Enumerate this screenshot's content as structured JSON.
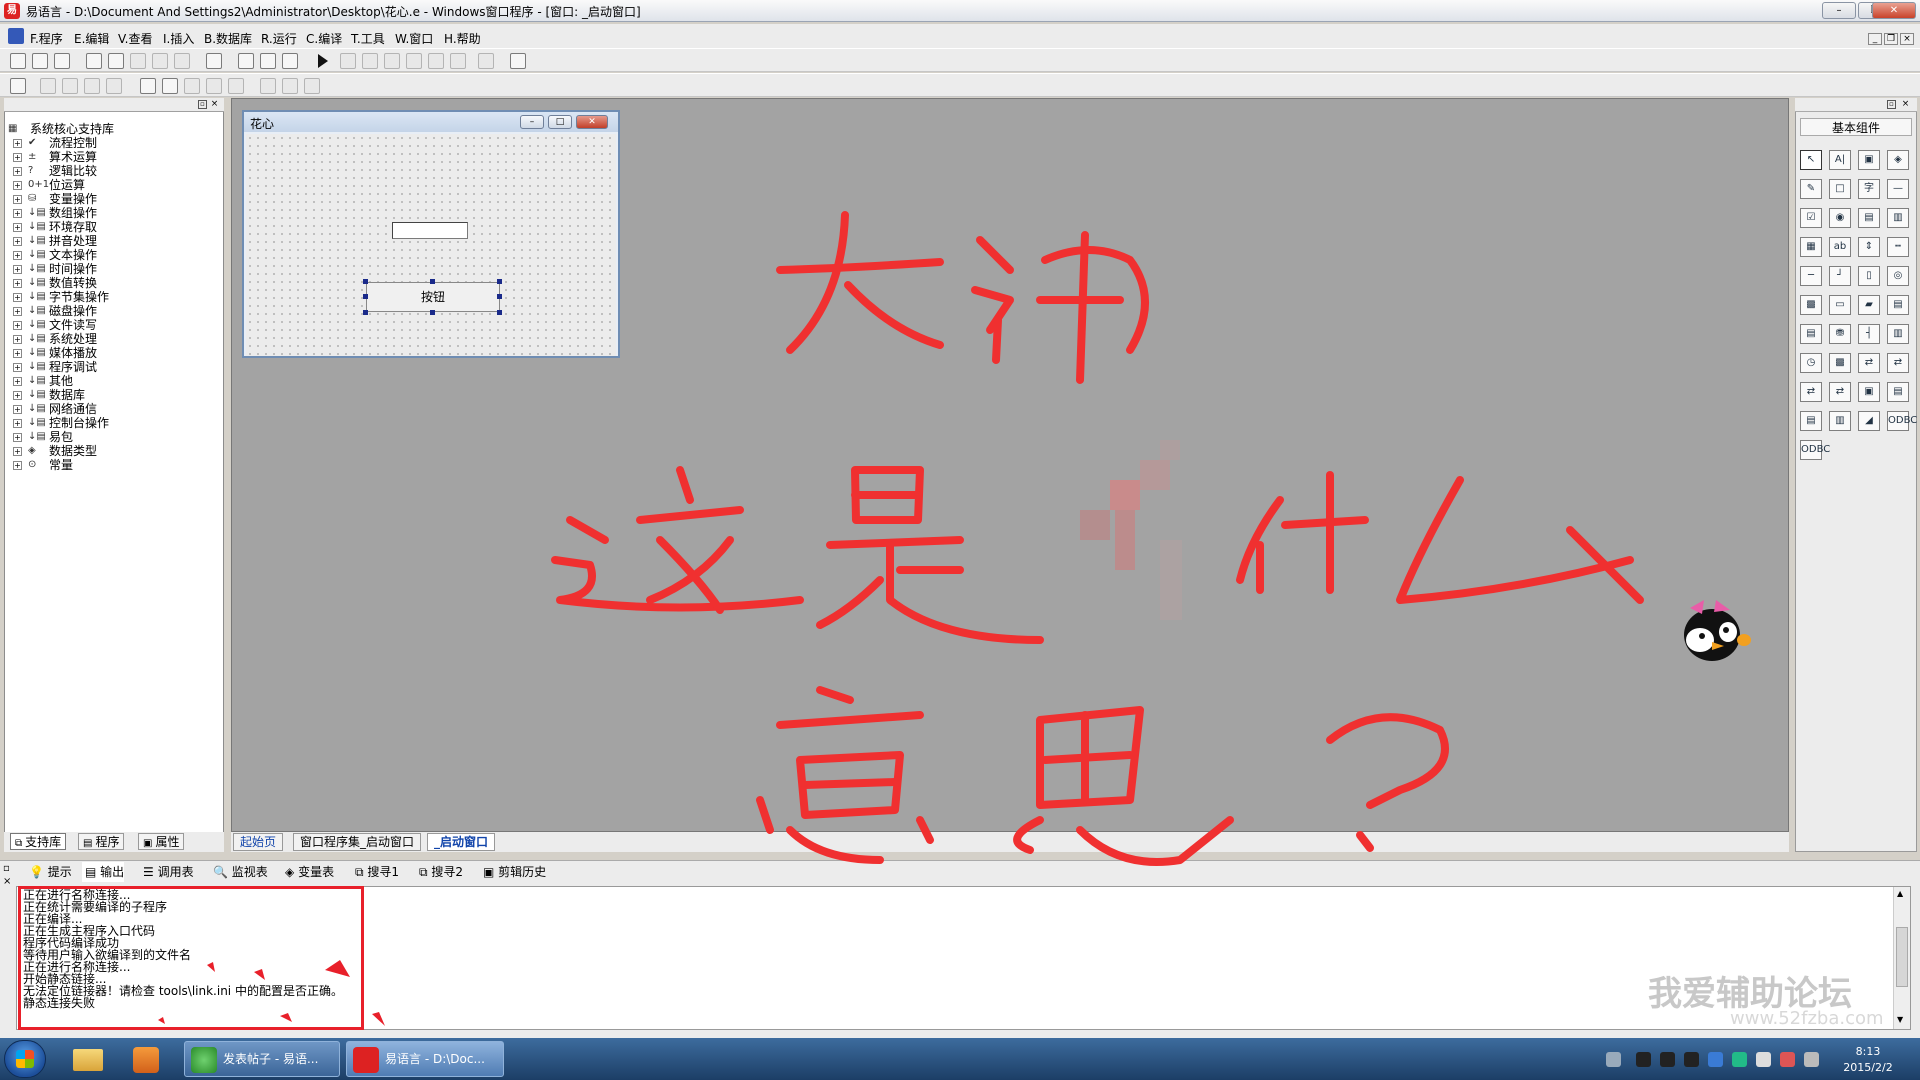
{
  "window": {
    "title": "易语言 - D:\\Document And Settings2\\Administrator\\Desktop\\花心.e - Windows窗口程序 - [窗口: _启动窗口]",
    "app_icon": "易",
    "minimize": "–",
    "maximize": "❐",
    "close": "✕"
  },
  "menu": [
    "F.程序",
    "E.编辑",
    "V.查看",
    "I.插入",
    "B.数据库",
    "R.运行",
    "C.编译",
    "T.工具",
    "W.窗口",
    "H.帮助"
  ],
  "left_panel": {
    "tree": [
      {
        "icon": "▦",
        "label": "系统核心支持库"
      },
      {
        "icon": "✔",
        "label": "流程控制"
      },
      {
        "icon": "±",
        "label": "算术运算"
      },
      {
        "icon": "?",
        "label": "逻辑比较"
      },
      {
        "icon": "0+1",
        "label": "位运算"
      },
      {
        "icon": "⛁",
        "label": "变量操作"
      },
      {
        "icon": "↓▤",
        "label": "数组操作"
      },
      {
        "icon": "↓▤",
        "label": "环境存取"
      },
      {
        "icon": "↓▤",
        "label": "拼音处理"
      },
      {
        "icon": "↓▤",
        "label": "文本操作"
      },
      {
        "icon": "↓▤",
        "label": "时间操作"
      },
      {
        "icon": "↓▤",
        "label": "数值转换"
      },
      {
        "icon": "↓▤",
        "label": "字节集操作"
      },
      {
        "icon": "↓▤",
        "label": "磁盘操作"
      },
      {
        "icon": "↓▤",
        "label": "文件读写"
      },
      {
        "icon": "↓▤",
        "label": "系统处理"
      },
      {
        "icon": "↓▤",
        "label": "媒体播放"
      },
      {
        "icon": "↓▤",
        "label": "程序调试"
      },
      {
        "icon": "↓▤",
        "label": "其他"
      },
      {
        "icon": "↓▤",
        "label": "数据库"
      },
      {
        "icon": "↓▤",
        "label": "网络通信"
      },
      {
        "icon": "↓▤",
        "label": "控制台操作"
      },
      {
        "icon": "↓▤",
        "label": "易包"
      },
      {
        "icon": "◈",
        "label": "数据类型"
      },
      {
        "icon": "⊙",
        "label": "常量"
      }
    ],
    "tabs": [
      "支持库",
      "程序",
      "属性"
    ]
  },
  "form": {
    "title": "花心",
    "button_label": "按钮",
    "textbox_value": ""
  },
  "doc_tabs": [
    "起始页",
    "窗口程序集_启动窗口",
    "_启动窗口"
  ],
  "right_panel": {
    "title": "基本组件",
    "components": [
      "↖",
      "A|",
      "▣",
      "◈",
      "✎",
      "□",
      "字",
      "—",
      "☑",
      "◉",
      "▤",
      "▥",
      "▦",
      "ab",
      "⇕",
      "┅",
      "─",
      "┘",
      "▯",
      "◎",
      "▩",
      "▭",
      "▰",
      "▤",
      "▤",
      "⛃",
      "┤",
      "▥",
      "◷",
      "▩",
      "⇄",
      "⇄",
      "⇄",
      "⇄",
      "▣",
      "▤",
      "▤",
      "▥",
      "◢",
      "ODBC",
      "ODBC"
    ]
  },
  "bottom_tabs": [
    "提示",
    "输出",
    "调用表",
    "监视表",
    "变量表",
    "搜寻1",
    "搜寻2",
    "剪辑历史"
  ],
  "output_lines": [
    "正在进行名称连接...",
    "正在统计需要编译的子程序",
    "正在编译...",
    "正在生成主程序入口代码",
    "程序代码编译成功",
    "等待用户输入欲编译到的文件名",
    "正在进行名称连接...",
    "开始静态链接...",
    "无法定位链接器！请检查 tools\\link.ini 中的配置是否正确。",
    "静态连接失败"
  ],
  "annotation": {
    "handwriting": "大神 这是什么意思？",
    "color": "#f03030"
  },
  "watermark": {
    "text": "我爱辅助论坛",
    "sub": "www.52fzba.com"
  },
  "taskbar": {
    "apps": [
      {
        "label": "发表帖子 - 易语..."
      },
      {
        "label": "易语言 - D:\\Doc..."
      }
    ],
    "clock_time": "8:13",
    "clock_date": "2015/2/2"
  },
  "colors": {
    "designer_bg": "#a3a3a3",
    "highlight_red": "#e8202a",
    "taskbar": "#2a5282"
  }
}
